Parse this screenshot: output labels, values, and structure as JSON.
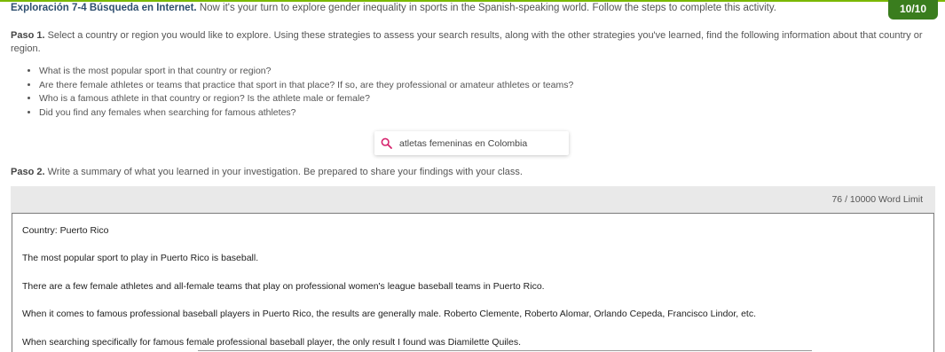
{
  "header": {
    "title": "Exploración 7-4 Búsqueda en Internet.",
    "instructions": "Now it's your turn to explore gender inequality in sports in the Spanish-speaking world. Follow the steps to complete this activity.",
    "score": "10/10"
  },
  "paso1": {
    "label": "Paso 1.",
    "text": "Select a country or region you would like to explore. Using these strategies to assess your search results, along with the other strategies you've learned, find the following information about that country or region.",
    "questions": [
      "What is the most popular sport in that country or region?",
      "Are there female athletes or teams that practice that sport in that place? If so, are they professional or amateur athletes or teams?",
      "Who is a famous athlete in that country or region? Is the athlete male or female?",
      "Did you find any females when searching for famous athletes?"
    ]
  },
  "search": {
    "icon": "search-icon",
    "query": "atletas femeninas en Colombia",
    "icon_color": "#d6246e"
  },
  "paso2": {
    "label": "Paso 2.",
    "text": "Write a summary of what you learned in your investigation. Be prepared to share your findings with your class."
  },
  "editor": {
    "word_count": "76 /  10000 Word Limit",
    "paragraphs": [
      "Country: Puerto Rico",
      "The most popular sport to play in Puerto Rico is baseball.",
      "There are a few female athletes and all-female teams that play on professional women's league baseball teams in Puerto Rico.",
      "When it comes to famous professional baseball players in Puerto Rico, the results are generally male.  Roberto Clemente, Roberto Alomar,  Orlando Cepeda, Francisco Lindor, etc.",
      "When searching specifically for famous female professional baseball player, the only result I found was Diamilette Quiles."
    ]
  },
  "colors": {
    "accent_green": "#7ab800",
    "badge_green": "#3a7d1e",
    "title_blue": "#2f4f6f"
  }
}
